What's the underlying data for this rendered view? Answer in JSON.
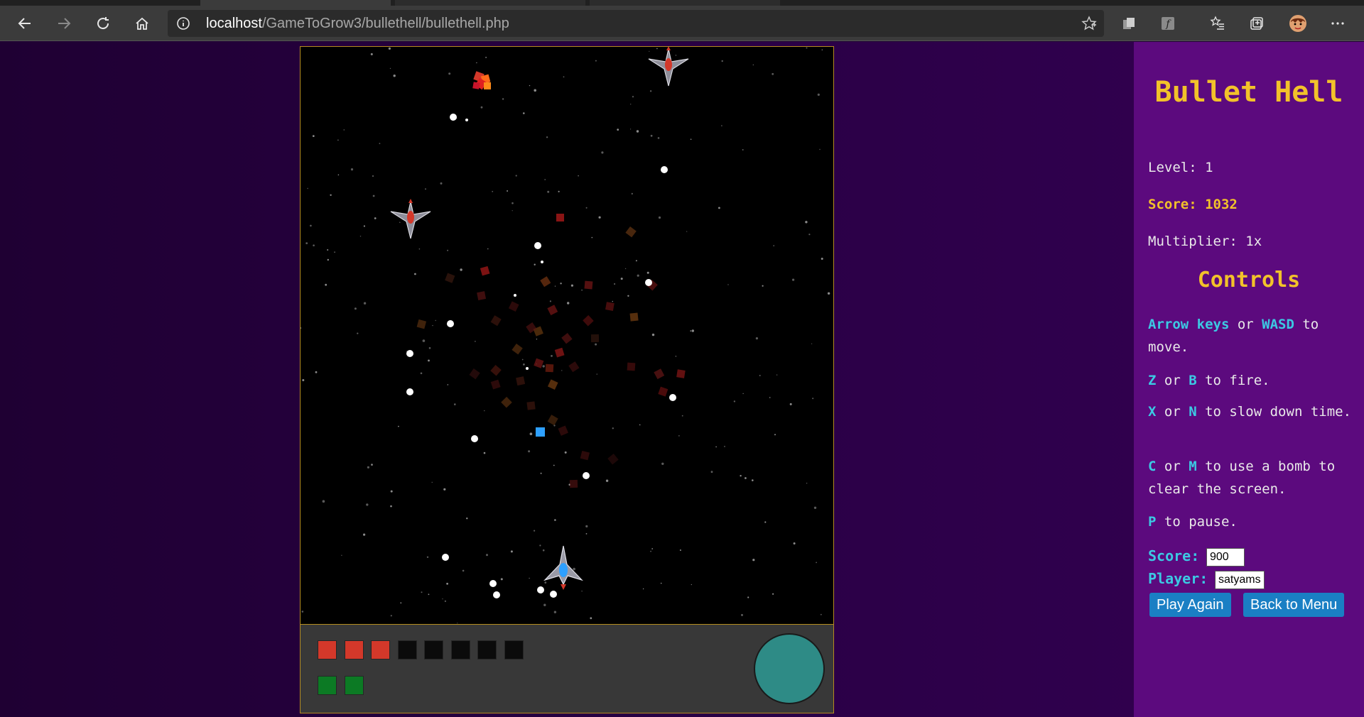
{
  "browser": {
    "url_host": "localhost",
    "url_path": "/GameToGrow3/bullethell/bullethell.php"
  },
  "game": {
    "lives_total": 8,
    "lives_remaining": 3,
    "bombs": 2,
    "colors": {
      "background": "#000000",
      "player_bullet": "#2ea0ff",
      "enemy_bullet": "#ffffff",
      "life_full": "#d3382a",
      "bomb": "#0c7a24",
      "slow_meter": "#2e8b86"
    }
  },
  "sidebar": {
    "title": "Bullet Hell",
    "level": "Level: 1",
    "score": "Score: 1032",
    "multiplier": "Multiplier: 1x",
    "controls_title": "Controls",
    "controls": {
      "move_key1": "Arrow keys",
      "move_mid": " or ",
      "move_key2": "WASD",
      "move_text": " to move.",
      "fire_key1": "Z",
      "fire_mid": " or ",
      "fire_key2": "B",
      "fire_text": " to fire.",
      "slow_key1": "X",
      "slow_mid": " or ",
      "slow_key2": "N",
      "slow_text": " to slow down time.",
      "bomb_key1": "C",
      "bomb_mid": " or ",
      "bomb_key2": "M",
      "bomb_text": " to use a bomb to clear the screen.",
      "pause_key": "P",
      "pause_text": " to pause."
    },
    "form": {
      "score_label": "Score:",
      "score_value": "900",
      "player_label": "Player:",
      "player_value": "satyams"
    },
    "buttons": {
      "play_again": "Play Again",
      "back_to_menu": "Back to Menu"
    }
  }
}
